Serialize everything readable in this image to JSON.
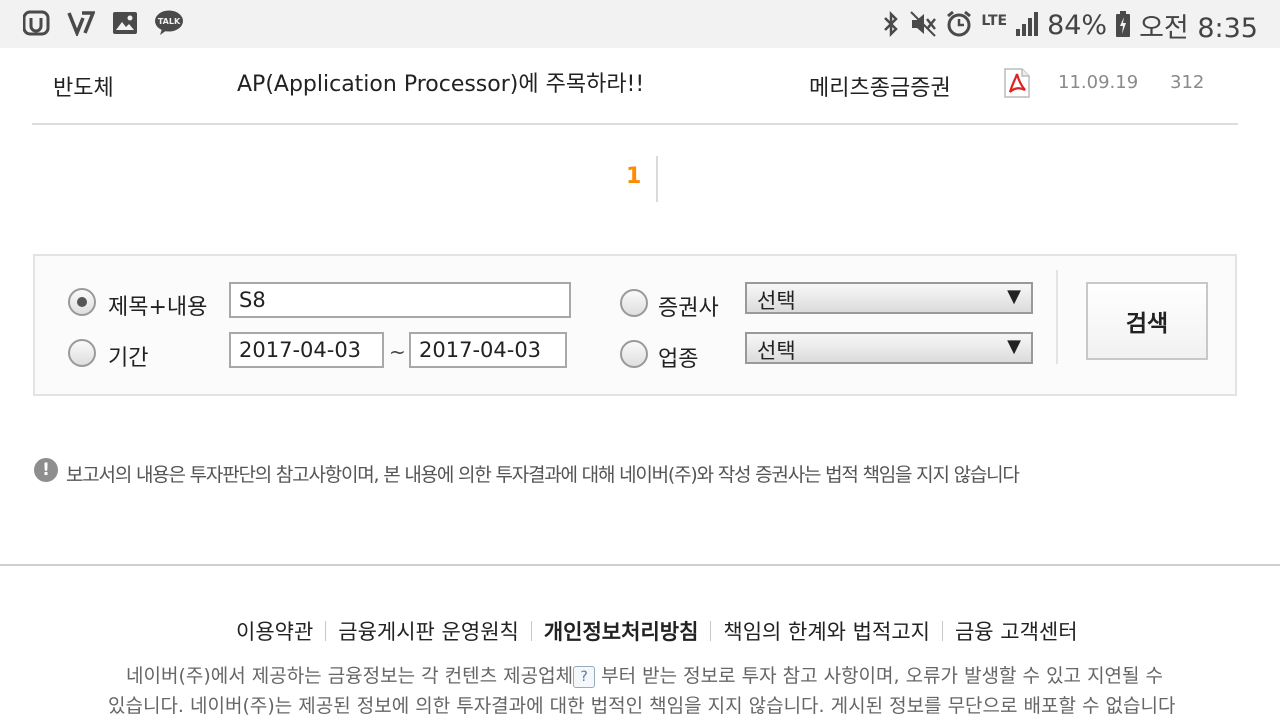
{
  "status_bar": {
    "left_icons": [
      "u-plus-icon",
      "v-app-icon",
      "gallery-icon",
      "kakaotalk-icon"
    ],
    "talk_label": "TALK",
    "network": "LTE",
    "battery": "84%",
    "time": "오전 8:35"
  },
  "report_row": {
    "category": "반도체",
    "title": "AP(Application Processor)에 주목하라!!",
    "broker": "메리츠종금증권",
    "file_icon": "pdf-icon",
    "date": "11.09.19",
    "views": "312"
  },
  "pagination": {
    "current": "1"
  },
  "search": {
    "radio_title_label": "제목+내용",
    "radio_period_label": "기간",
    "keyword_value": "S8",
    "date_from": "2017-04-03",
    "date_sep": "~",
    "date_to": "2017-04-03",
    "radio_broker_label": "증권사",
    "broker_select": "선택",
    "radio_industry_label": "업종",
    "industry_select": "선택",
    "search_button": "검색"
  },
  "notice": "보고서의 내용은 투자판단의 참고사항이며, 본 내용에 의한 투자결과에 대해 네이버(주)와 작성 증권사는 법적 책임을 지지 않습니다",
  "footer": {
    "links": [
      "이용약관",
      "금융게시판 운영원칙",
      "개인정보처리방침",
      "책임의 한계와 법적고지",
      "금융 고객센터"
    ],
    "line1_a": "네이버(주)에서 제공하는 금융정보는 각 컨텐츠 제공업체",
    "line1_b": " 부터 받는 정보로 투자 참고 사항이며, 오류가 발생할 수 있고 지연될 수",
    "line2": "있습니다. 네이버(주)는 제공된 정보에 의한 투자결과에 대한 법적인 책임을 지지 않습니다. 게시된 정보를 무단으로 배포할 수 없습니다"
  }
}
